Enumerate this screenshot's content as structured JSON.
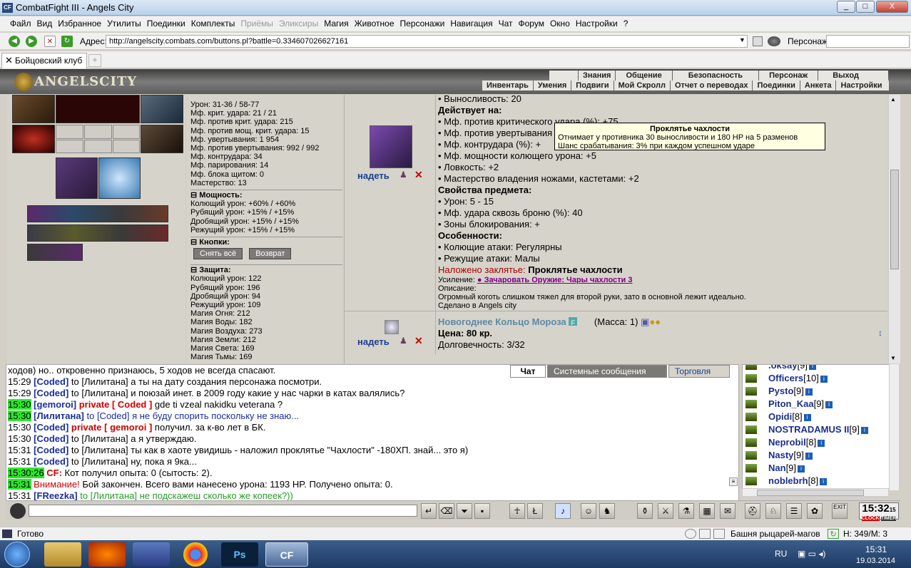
{
  "window": {
    "title": "CombatFight III - Angels City",
    "min": "_",
    "max": "□",
    "close": "X"
  },
  "menu": [
    "Файл",
    "Вид",
    "Избранное",
    "Утилиты",
    "Поединки",
    "Комплекты",
    "Приёмы",
    "Эликсиры",
    "Магия",
    "Животное",
    "Персонажи",
    "Навигация",
    "Чат",
    "Форум",
    "Окно",
    "Настройки",
    "?"
  ],
  "address": {
    "label": "Адрес:",
    "url": "http://angelscity.combats.com/buttons.pl?battle=0.334607026627161",
    "persona_label": "Персонаж:"
  },
  "tab": {
    "label": "Бойцовский клуб",
    "new": "+"
  },
  "game": {
    "logo": "ANGELSCITY",
    "nav_top": [
      "Знания",
      "Общение",
      "Безопасность",
      "Персонаж",
      "Выход"
    ],
    "nav_bottom": [
      "Инвентарь",
      "Умения",
      "Подвиги",
      "Мой Скролл",
      "Отчет о переводах",
      "Поединки",
      "Анкета",
      "Настройки"
    ]
  },
  "stats": {
    "lines_a": [
      "Урон: 31-36 / 58-77",
      "Мф. крит. удара: 21 / 21",
      "Мф. против крит. удара: 215",
      "Мф. против мощ. крит. удара: 15",
      "Мф. увертывания: 1 954",
      "Мф. против увертывания: 992 / 992",
      "Мф. контрудара: 34",
      "Мф. парирования: 14",
      "Мф. блока щитом: 0",
      "Мастерство: 13"
    ],
    "sec_power": "Мощность:",
    "lines_b": [
      "Колющий урон: +60% / +60%",
      "Рубящий урон: +15% / +15%",
      "Дробящий урон: +15% / +15%",
      "Режущий урон: +15% / +15%"
    ],
    "sec_buttons": "Кнопки:",
    "btn_remove": "Снять всё",
    "btn_return": "Возврат",
    "sec_defense": "Защита:",
    "lines_c": [
      "Колющий урон: 122",
      "Рубящий урон: 196",
      "Дробящий урон: 94",
      "Режущий урон: 109",
      "Магия Огня: 212",
      "Магия Воды: 182",
      "Магия Воздуха: 273",
      "Магия Земли: 212",
      "Магия Света: 169",
      "Магия Тьмы: 169"
    ]
  },
  "item1": {
    "wear": "надеть",
    "l_endurance": "• Выносливость: 20",
    "acts_title": "Действует на:",
    "acts": [
      "• Мф. против критического удара (%): +75",
      "• Мф. против увертывания (%): +",
      "• Мф. контрудара (%): +",
      "• Мф. мощности колющего урона: +5",
      "• Ловкость: +2",
      "• Мастерство владения ножами, кастетами: +2"
    ],
    "props_title": "Свойства предмета:",
    "props": [
      "• Урон: 5 - 15",
      "• Мф. удара сквозь броню (%): 40",
      "• Зоны блокирования: +"
    ],
    "feat_title": "Особенности:",
    "feats": [
      "• Колющие атаки: Регулярны",
      "• Режущие атаки: Малы"
    ],
    "spell_label": "Наложено заклятье:",
    "spell_name": "Проклятье чахлости",
    "upgrade_label": "Усиление:",
    "upgrade_link": "Зачаровать Оружие: Чары чахлости 3",
    "desc_label": "Описание:",
    "desc": "Огромный коготь слишком тяжел для второй руки, зато в основной лежит идеально.",
    "made": "Сделано в Angels city"
  },
  "item2": {
    "wear": "надеть",
    "name": "Новогоднее Кольцо Мороза",
    "mass": "(Масса: 1)",
    "price": "Цена: 80 кр.",
    "durability": "Долговечность: 3/32"
  },
  "tooltip": {
    "title": "Проклятье чахлости",
    "l1": "Отнимает у противника 30 выносливости и 180 HP на 5 разменов",
    "l2": "Шанс срабатывания: 3% при каждом успешном ударе"
  },
  "chattabs": [
    "Чат",
    "Системные сообщения",
    "Торговля"
  ],
  "chat": [
    {
      "ts": "",
      "t": "ходов) но.. откровенно признаюсь, 5 ходов не всегда спасают."
    },
    {
      "ts": "15:29",
      "n": "[Coded]",
      "t": " to [Лилитана] а ты на дату создания персонажа посмотри."
    },
    {
      "ts": "15:29",
      "n": "[Coded]",
      "t": " to [Лилитана] и поюзай инет. в 2009 году какие у нас чарки в катах валялись?"
    },
    {
      "ts": "15:30",
      "n": "[gemoroi]",
      "p": " private [ Coded ]",
      "t": " gde ti vzeal nakidku veterana ?"
    },
    {
      "ts": "15:30",
      "n": "[Лилитана]",
      "t": " to [Coded] я не буду спорить поскольку не знаю..."
    },
    {
      "ts": "15:30",
      "n": "[Coded]",
      "p": " private [ gemoroi ]",
      "t": " получил. за к-во лет в БК."
    },
    {
      "ts": "15:30",
      "n": "[Coded]",
      "t": " to [Лилитана] а я утверждаю."
    },
    {
      "ts": "15:31",
      "n": "[Coded]",
      "t": " to [Лилитана] ты как в хаоте увидишь - наложил проклятье \"Чахлости\" -180ХП. знай... это я)"
    },
    {
      "ts": "15:31",
      "n": "[Coded]",
      "t": " to [Лилитана] ну, пока я 9ка..."
    },
    {
      "ts": "15:30:26",
      "n": "CF:",
      "t": " Кот получил опыта: 0 (сытость: 2)."
    },
    {
      "ts": "15:31",
      "n": "Внимание!",
      "t": " Бой закончен. Всего вами нанесено урона: 1193 HP. Получено опыта: 0."
    },
    {
      "ts": "15:31",
      "n": "[FReezka]",
      "t": " to [Лилитана] не подскажеш сколько же копеек?))"
    }
  ],
  "users": [
    {
      "n": ".oksay",
      "l": "[9]"
    },
    {
      "n": "Officers",
      "l": "[10]"
    },
    {
      "n": "Pysto",
      "l": "[9]"
    },
    {
      "n": "Piton_Kaa",
      "l": "[9]"
    },
    {
      "n": "Opidi",
      "l": "[8]"
    },
    {
      "n": "NOSTRADAMUS II",
      "l": "[9]"
    },
    {
      "n": "Neprobil",
      "l": "[8]"
    },
    {
      "n": "Nasty",
      "l": "[9]"
    },
    {
      "n": "Nan",
      "l": "[9]"
    },
    {
      "n": "noblebrh",
      "l": "[8]"
    }
  ],
  "clock": {
    "time": "15:32",
    "sec": "15",
    "l1": "CLOCK",
    "l2": "TIMER",
    "exit": "EXIT"
  },
  "status": {
    "ready": "Готово",
    "location": "Башня рыцарей-магов",
    "hp": "H: 349/M: 3"
  },
  "tray": {
    "lang": "RU",
    "time": "15:31",
    "date": "19.03.2014"
  }
}
